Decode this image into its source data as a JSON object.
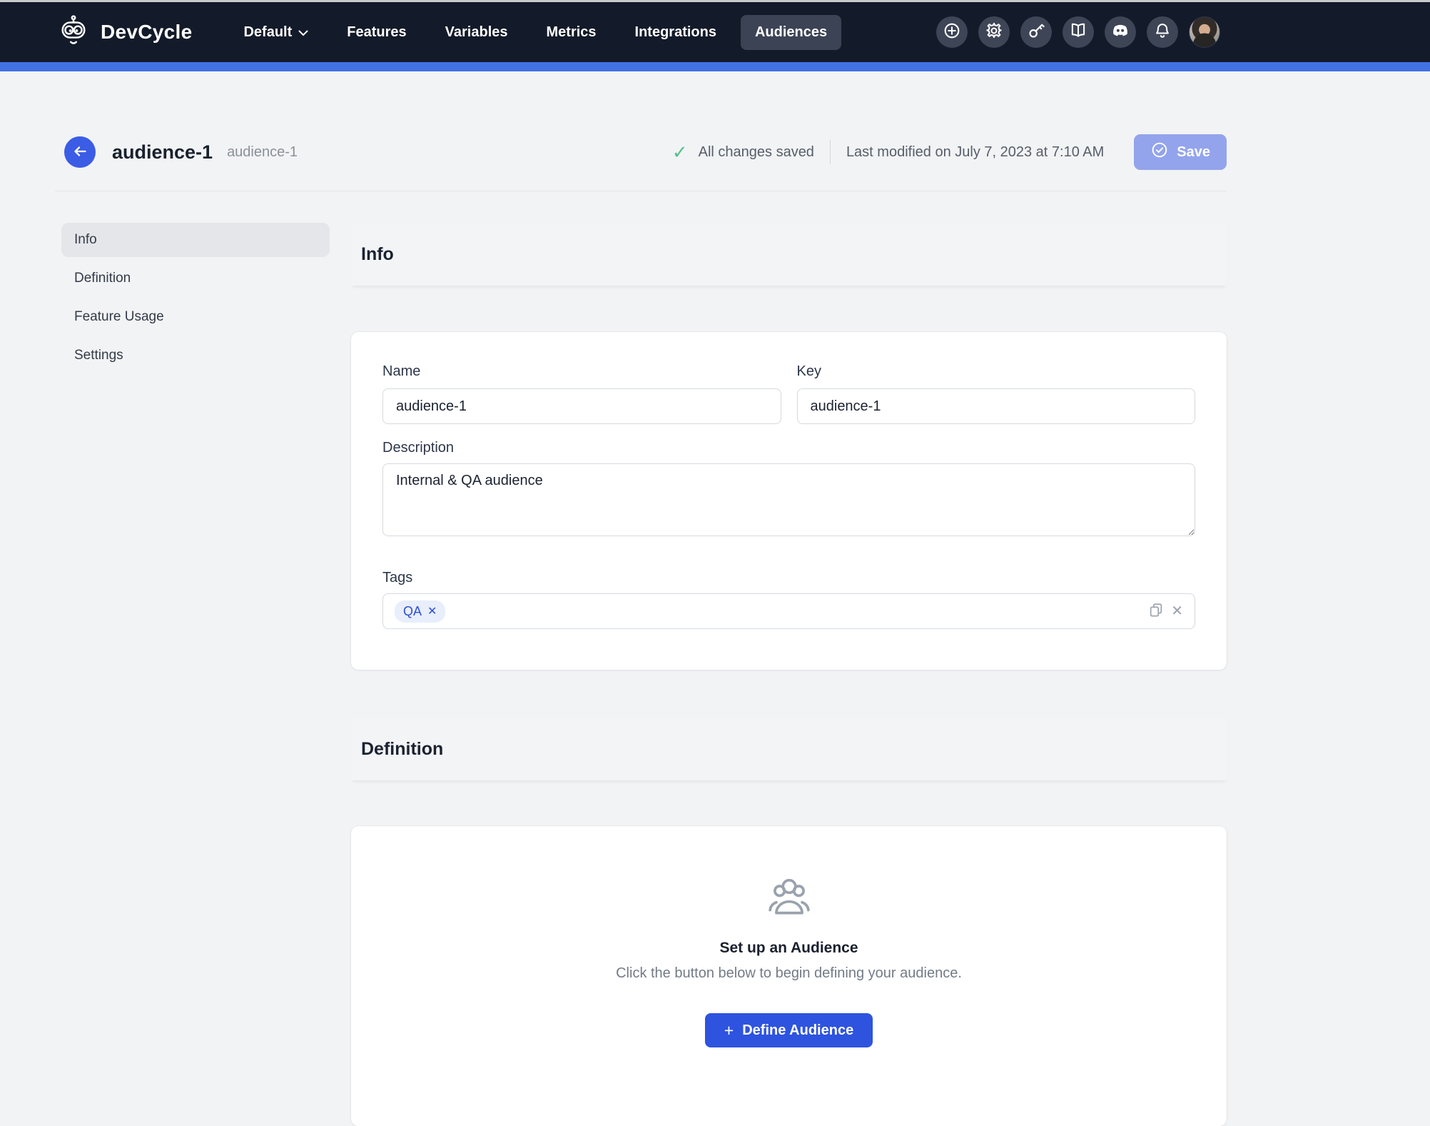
{
  "navbar": {
    "brand": "DevCycle",
    "project_selector": "Default",
    "links": [
      "Features",
      "Variables",
      "Metrics",
      "Integrations",
      "Audiences"
    ],
    "active_link": "Audiences",
    "icon_names": [
      "plus-circle-icon",
      "gear-icon",
      "key-icon",
      "docs-book-icon",
      "discord-icon",
      "bell-icon",
      "user-avatar"
    ]
  },
  "header": {
    "title": "audience-1",
    "subtitle": "audience-1",
    "saved_status": "All changes saved",
    "last_modified": "Last modified on July 7, 2023 at 7:10 AM",
    "save_label": "Save"
  },
  "sidebar": {
    "items": [
      {
        "label": "Info",
        "active": true
      },
      {
        "label": "Definition",
        "active": false
      },
      {
        "label": "Feature Usage",
        "active": false
      },
      {
        "label": "Settings",
        "active": false
      }
    ]
  },
  "info_section": {
    "title": "Info",
    "fields": {
      "name": {
        "label": "Name",
        "value": "audience-1"
      },
      "key": {
        "label": "Key",
        "value": "audience-1"
      },
      "description": {
        "label": "Description",
        "value": "Internal & QA audience"
      },
      "tags": {
        "label": "Tags",
        "items": [
          "QA"
        ]
      }
    }
  },
  "definition_section": {
    "title": "Definition",
    "empty_state": {
      "title": "Set up an Audience",
      "subtitle": "Click the button below to begin defining your audience.",
      "button_label": "Define Audience"
    }
  },
  "colors": {
    "navbar_bg": "#131a29",
    "accent_bar": "#4271e3",
    "primary_blue": "#2e53df",
    "save_disabled": "#93a4ec",
    "tag_bg": "#e8eefb",
    "tag_text": "#2b4fd8",
    "success_green": "#57bf8e",
    "page_bg": "#f2f3f5"
  }
}
